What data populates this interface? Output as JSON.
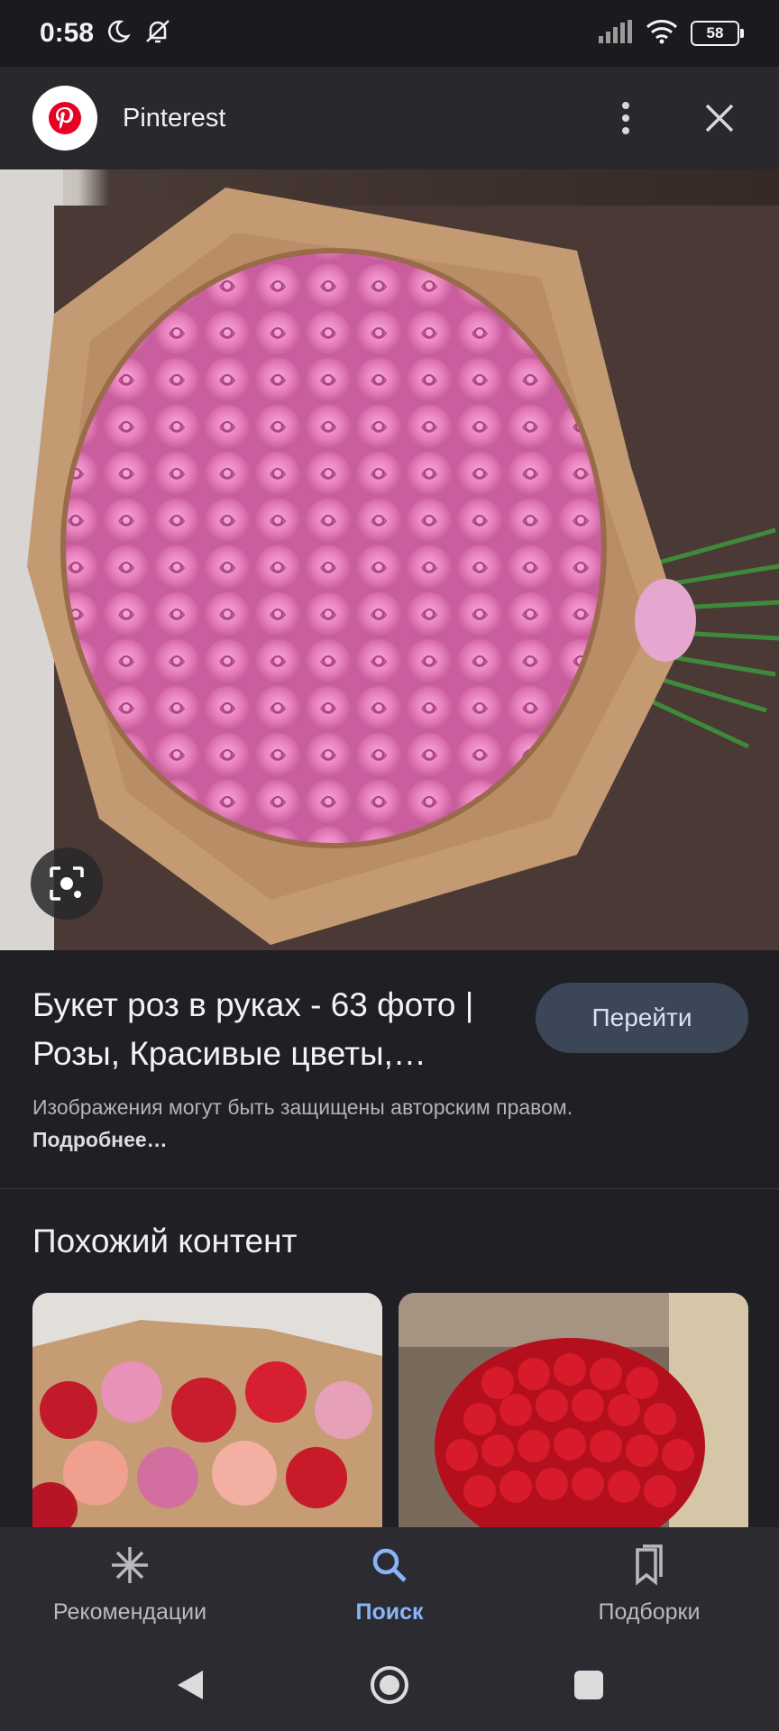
{
  "status_bar": {
    "time": "0:58",
    "battery": "58",
    "icons": [
      "moon-icon",
      "silent-icon",
      "signal-icon",
      "wifi-icon",
      "battery-icon"
    ]
  },
  "header": {
    "site_name": "Pinterest",
    "logo_icon": "pinterest-logo",
    "more_icon": "more-vert-icon",
    "close_icon": "close-icon"
  },
  "result": {
    "title": "Букет роз в руках - 63 фото | Розы, Красивые цветы,…",
    "go_button": "Перейти",
    "copyright_text": "Изображения могут быть защищены авторским правом.",
    "more_link": "Подробнее…"
  },
  "similar": {
    "title": "Похожий контент"
  },
  "bottom_nav": {
    "items": [
      {
        "label": "Рекомендации",
        "icon": "asterisk-icon",
        "active": false
      },
      {
        "label": "Поиск",
        "icon": "search-icon",
        "active": true
      },
      {
        "label": "Подборки",
        "icon": "collections-icon",
        "active": false
      }
    ]
  },
  "colors": {
    "accent": "#8ab4f8",
    "button_bg": "#3b4657",
    "background": "#1f1f24"
  }
}
